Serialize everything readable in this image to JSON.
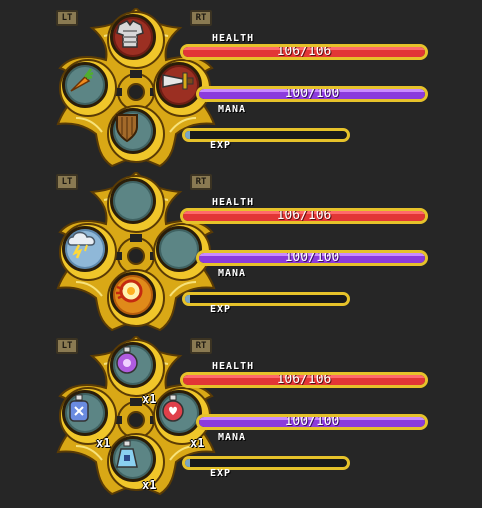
{
  "controller": {
    "left_trigger": "LT",
    "right_trigger": "RT"
  },
  "stats": {
    "health_label": "HEALTH",
    "health_value": "106/106",
    "health_fraction": 1.0,
    "mana_label": "MANA",
    "mana_value": "100/100",
    "mana_fraction": 1.0,
    "exp_label": "EXP",
    "exp_fraction": 0.03
  },
  "huds": [
    {
      "variant": "equipment",
      "slots": {
        "top": {
          "icon": "chest-armor-icon",
          "qty": ""
        },
        "left": {
          "icon": "carrot-icon",
          "qty": ""
        },
        "right": {
          "icon": "sword-icon",
          "qty": ""
        },
        "bottom": {
          "icon": "shield-icon",
          "qty": ""
        }
      }
    },
    {
      "variant": "spells",
      "slots": {
        "top": {
          "icon": "",
          "qty": ""
        },
        "left": {
          "icon": "storm-cloud-icon",
          "qty": ""
        },
        "right": {
          "icon": "",
          "qty": ""
        },
        "bottom": {
          "icon": "fireball-icon",
          "qty": ""
        }
      }
    },
    {
      "variant": "potions",
      "slots": {
        "top": {
          "icon": "purple-potion-icon",
          "qty": "x1"
        },
        "left": {
          "icon": "blue-potion-icon",
          "qty": "x1"
        },
        "right": {
          "icon": "red-potion-icon",
          "qty": "x1"
        },
        "bottom": {
          "icon": "light-blue-potion-icon",
          "qty": "x1"
        }
      }
    }
  ],
  "colors": {
    "gold": "#e6c22a",
    "health": "#e23636",
    "mana": "#8b3bdc",
    "exp": "#7aa6c4",
    "slot": "#5c8585"
  }
}
